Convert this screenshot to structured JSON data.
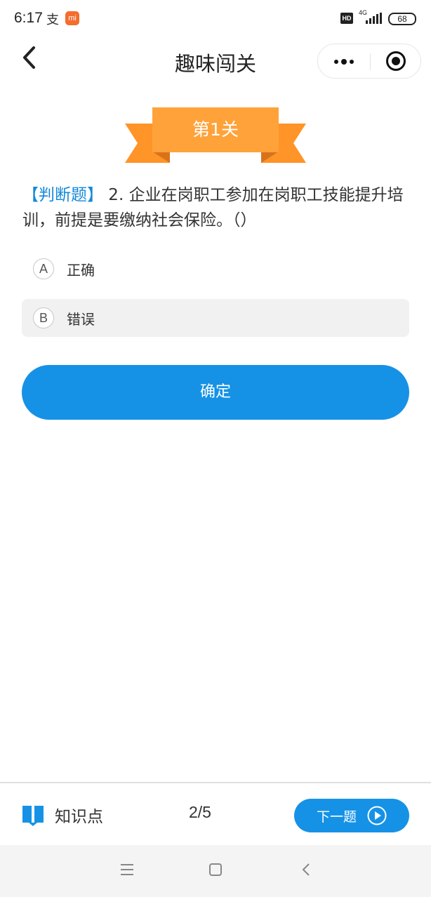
{
  "status_bar": {
    "time": "6:17",
    "alipay_glyph": "支",
    "mi_badge": "mi",
    "hd": "HD",
    "network": "4G",
    "battery": "68"
  },
  "nav": {
    "title": "趣味闯关",
    "back_icon": "chevron-left-icon",
    "more_icon": "more-dots-icon",
    "close_icon": "target-icon"
  },
  "level": {
    "ribbon_text": "第1关",
    "ribbon_color": "#ffa23a",
    "ribbon_tail_color": "#ff9428"
  },
  "question": {
    "type_label": "【判断题】",
    "text": " 2. 企业在岗职工参加在岗职工技能提升培训，前提是要缴纳社会保险。（）"
  },
  "options": [
    {
      "letter": "A",
      "text": "正确",
      "selected": false
    },
    {
      "letter": "B",
      "text": "错误",
      "selected": true
    }
  ],
  "confirm_label": "确定",
  "bottom": {
    "knowledge_label": "知识点",
    "progress": "2/5",
    "next_label": "下一题",
    "book_icon": "book-icon",
    "play_icon": "play-circle-icon"
  },
  "colors": {
    "accent": "#1592e6",
    "type_label": "#1489d9"
  }
}
